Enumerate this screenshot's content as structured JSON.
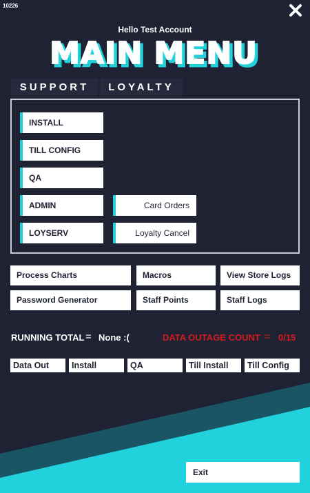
{
  "window": {
    "id_label": "10226",
    "close_icon": "close-x-icon"
  },
  "header": {
    "greeting": "Hello Test Account",
    "title": "MAIN MENU"
  },
  "tabs": [
    {
      "label": "SUPPORT"
    },
    {
      "label": "LOYALTY"
    }
  ],
  "panel": {
    "left_buttons": [
      "INSTALL",
      "TILL CONFIG",
      "QA",
      "ADMIN",
      "LOYSERV"
    ],
    "right_buttons": [
      "Card Orders",
      "Loyalty Cancel"
    ]
  },
  "tools": {
    "row1": [
      "Process Charts",
      "Macros",
      "View Store Logs"
    ],
    "row2": [
      "Password Generator",
      "Staff Points",
      "Staff Logs"
    ]
  },
  "status": {
    "running_total_label": "RUNNING TOTAL",
    "running_total_eq": "=",
    "running_total_value": "None :(",
    "outage_label": "DATA OUTAGE COUNT",
    "outage_eq": "=",
    "outage_value": "0/15"
  },
  "quick_actions": [
    "Data Out",
    "Install",
    "QA",
    "Till Install",
    "Till Config"
  ],
  "footer": {
    "exit_label": "Exit"
  },
  "colors": {
    "background": "#1e2233",
    "accent": "#21d2dc",
    "alert": "#d31b1b",
    "button": "#ffffff"
  }
}
